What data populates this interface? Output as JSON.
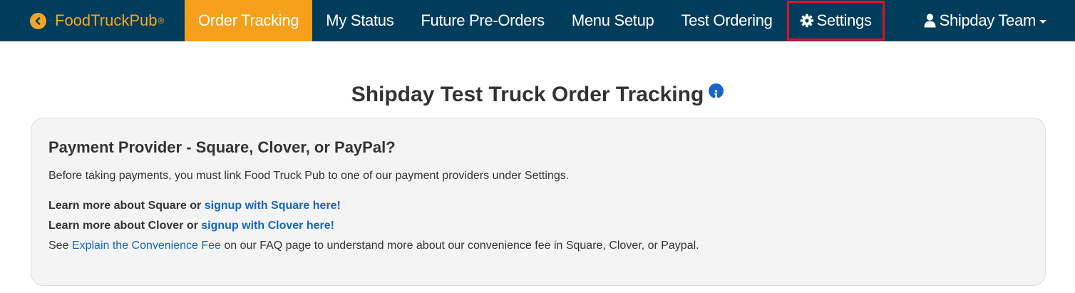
{
  "colors": {
    "navbar_bg": "#003d5c",
    "brand": "#f5a623",
    "active_tab_bg": "#f5a01a",
    "highlight_outline": "#e3101f",
    "link": "#1466c0",
    "info_icon": "#1a66c8"
  },
  "navbar": {
    "brand": {
      "name": "FoodTruckPub",
      "mark": "®",
      "icon": "chevron-left-circle-icon"
    },
    "items": [
      {
        "label": "Order Tracking",
        "active": true
      },
      {
        "label": "My Status",
        "active": false
      },
      {
        "label": "Future Pre-Orders",
        "active": false
      },
      {
        "label": "Menu Setup",
        "active": false
      },
      {
        "label": "Test Ordering",
        "active": false
      },
      {
        "label": "Settings",
        "active": false,
        "icon": "gear-icon",
        "highlighted": true
      }
    ],
    "user": {
      "label": "Shipday Team",
      "icon": "user-icon"
    }
  },
  "main": {
    "title": "Shipday Test Truck Order Tracking",
    "title_icon": "info-icon"
  },
  "panel": {
    "heading": "Payment Provider - Square, Clover, or PayPal?",
    "intro": "Before taking payments, you must link Food Truck Pub to one of our payment providers under Settings.",
    "square_text": "Learn more about Square or",
    "square_link": "signup with Square here!",
    "clover_text": "Learn more about Clover or",
    "clover_link": "signup with Clover here!",
    "fee_prefix": "See",
    "fee_link": "Explain the Convenience Fee",
    "fee_suffix": "on our FAQ page to understand more about our convenience fee in Square, Clover, or Paypal."
  }
}
